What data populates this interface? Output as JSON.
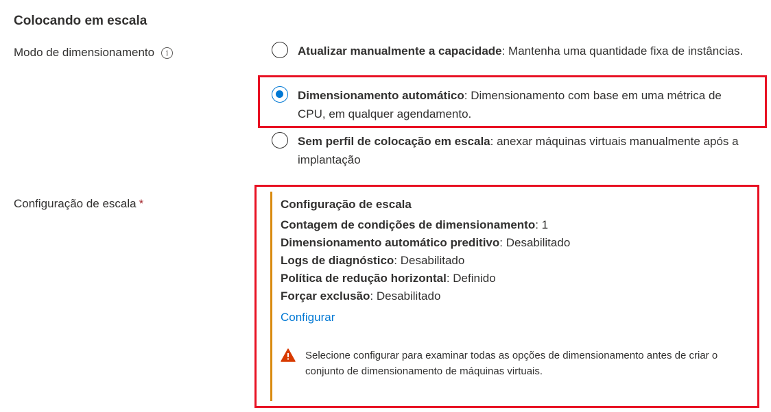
{
  "section": {
    "title": "Colocando em escala"
  },
  "scaling_mode": {
    "label": "Modo de dimensionamento",
    "info_icon": "i",
    "options": [
      {
        "title": "Atualizar manualmente a capacidade",
        "description": ": Mantenha uma quantidade fixa de instâncias.",
        "selected": false
      },
      {
        "title": "Dimensionamento automático",
        "description": ": Dimensionamento com base em uma métrica de CPU, em qualquer agendamento.",
        "selected": true
      },
      {
        "title": "Sem perfil de colocação em escala",
        "description": ": anexar máquinas virtuais manualmente após a implantação",
        "selected": false
      }
    ]
  },
  "scale_config": {
    "label": "Configuração de escala",
    "required_mark": "*",
    "panel_title": "Configuração de escala",
    "rows": [
      {
        "key": "Contagem de condições de dimensionamento",
        "value": ": 1"
      },
      {
        "key": "Dimensionamento automático preditivo",
        "value": ": Desabilitado"
      },
      {
        "key": "Logs de diagnóstico",
        "value": ": Desabilitado"
      },
      {
        "key": "Política de redução horizontal",
        "value": ": Definido"
      },
      {
        "key": "Forçar exclusão",
        "value": ": Desabilitado"
      }
    ],
    "configure_link": "Configurar",
    "warning": "Selecione configurar para examinar todas as opções de dimensionamento antes de criar o conjunto de dimensionamento de máquinas virtuais."
  },
  "colors": {
    "accent": "#0078d4",
    "highlight": "#e81123",
    "warning_bar": "#d98b10",
    "warning_icon": "#d83b01"
  }
}
